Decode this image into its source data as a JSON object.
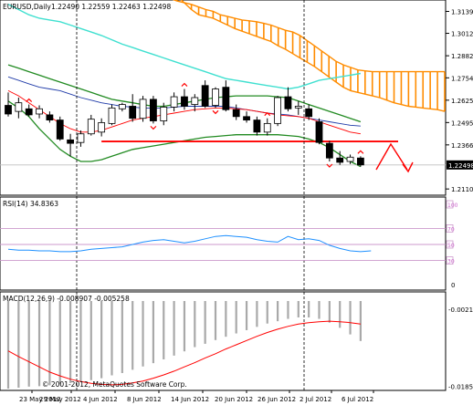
{
  "header": {
    "symbol": "EURUSD,Daily",
    "ohlc": "1.22490 1.22559 1.22463 1.22498"
  },
  "rsi_title": "RSI(14) 34.8363",
  "macd_title": "MACD(12,26,9) -0.008907 -0.005258",
  "copyright": "© 2001-2012, MetaQuotes Software Corp.",
  "colors": {
    "bull": "#ffffff",
    "bear": "#000000",
    "cloud": "#ff8c00",
    "upper_band": "#40e0d0",
    "envelope": "#228b22",
    "ma_red": "#ff0000",
    "ma_blue": "#1e3aa8",
    "rsi_line": "#1e90ff",
    "level": "#cc99cc",
    "macd_hist": "#a9a9a9",
    "macd_signal": "#ff0000",
    "price_line": "#ff0000"
  },
  "chart_data": [
    {
      "type": "candlestick",
      "symbol": "EURUSD,Daily",
      "x_tick_labels": [
        "23 May 2012",
        "29 May 2012",
        "4 Jun 2012",
        "8 Jun 2012",
        "14 Jun 2012",
        "20 Jun 2012",
        "26 Jun 2012",
        "2 Jul 2012",
        "6 Jul 2012"
      ],
      "y_tick_labels": [
        "1.31395",
        "1.30125",
        "1.28825",
        "1.27545",
        "1.26250",
        "1.24955",
        "1.23660",
        "1.22498",
        "1.21105"
      ],
      "ylim": [
        1.2085,
        1.3195
      ],
      "current_price": 1.22498,
      "horizontal_line": 1.2386,
      "candles": [
        {
          "o": 1.2595,
          "h": 1.267,
          "l": 1.253,
          "c": 1.2545
        },
        {
          "o": 1.256,
          "h": 1.264,
          "l": 1.252,
          "c": 1.261
        },
        {
          "o": 1.2575,
          "h": 1.26,
          "l": 1.253,
          "c": 1.254
        },
        {
          "o": 1.2545,
          "h": 1.2595,
          "l": 1.252,
          "c": 1.2575
        },
        {
          "o": 1.254,
          "h": 1.256,
          "l": 1.2495,
          "c": 1.251
        },
        {
          "o": 1.251,
          "h": 1.253,
          "l": 1.239,
          "c": 1.24
        },
        {
          "o": 1.2395,
          "h": 1.243,
          "l": 1.23,
          "c": 1.2375
        },
        {
          "o": 1.238,
          "h": 1.245,
          "l": 1.2355,
          "c": 1.243
        },
        {
          "o": 1.243,
          "h": 1.254,
          "l": 1.242,
          "c": 1.2515
        },
        {
          "o": 1.244,
          "h": 1.252,
          "l": 1.2415,
          "c": 1.2495
        },
        {
          "o": 1.249,
          "h": 1.26,
          "l": 1.248,
          "c": 1.258
        },
        {
          "o": 1.2575,
          "h": 1.261,
          "l": 1.256,
          "c": 1.26
        },
        {
          "o": 1.259,
          "h": 1.266,
          "l": 1.25,
          "c": 1.252
        },
        {
          "o": 1.252,
          "h": 1.265,
          "l": 1.25,
          "c": 1.263
        },
        {
          "o": 1.263,
          "h": 1.265,
          "l": 1.249,
          "c": 1.2505
        },
        {
          "o": 1.2505,
          "h": 1.261,
          "l": 1.248,
          "c": 1.2585
        },
        {
          "o": 1.2585,
          "h": 1.267,
          "l": 1.256,
          "c": 1.2645
        },
        {
          "o": 1.2645,
          "h": 1.269,
          "l": 1.257,
          "c": 1.259
        },
        {
          "o": 1.26,
          "h": 1.266,
          "l": 1.256,
          "c": 1.264
        },
        {
          "o": 1.271,
          "h": 1.274,
          "l": 1.258,
          "c": 1.259
        },
        {
          "o": 1.2595,
          "h": 1.27,
          "l": 1.258,
          "c": 1.269
        },
        {
          "o": 1.27,
          "h": 1.274,
          "l": 1.256,
          "c": 1.257
        },
        {
          "o": 1.257,
          "h": 1.26,
          "l": 1.251,
          "c": 1.253
        },
        {
          "o": 1.253,
          "h": 1.256,
          "l": 1.2495,
          "c": 1.251
        },
        {
          "o": 1.251,
          "h": 1.253,
          "l": 1.242,
          "c": 1.244
        },
        {
          "o": 1.244,
          "h": 1.252,
          "l": 1.242,
          "c": 1.249
        },
        {
          "o": 1.249,
          "h": 1.265,
          "l": 1.2475,
          "c": 1.264
        },
        {
          "o": 1.2645,
          "h": 1.27,
          "l": 1.256,
          "c": 1.2575
        },
        {
          "o": 1.258,
          "h": 1.262,
          "l": 1.254,
          "c": 1.259
        },
        {
          "o": 1.2575,
          "h": 1.26,
          "l": 1.251,
          "c": 1.253
        },
        {
          "o": 1.25,
          "h": 1.252,
          "l": 1.237,
          "c": 1.238
        },
        {
          "o": 1.2375,
          "h": 1.239,
          "l": 1.227,
          "c": 1.229
        },
        {
          "o": 1.229,
          "h": 1.233,
          "l": 1.225,
          "c": 1.2265
        },
        {
          "o": 1.227,
          "h": 1.231,
          "l": 1.2255,
          "c": 1.2295
        },
        {
          "o": 1.229,
          "h": 1.23,
          "l": 1.224,
          "c": 1.225
        }
      ],
      "overlays": {
        "cloud_upper": [
          1.325,
          1.323,
          1.3215,
          1.32,
          1.319,
          1.318,
          1.3165,
          1.315,
          1.314,
          1.312,
          1.311,
          1.31,
          1.309,
          1.3085,
          1.308,
          1.307,
          1.306,
          1.3045,
          1.303,
          1.302,
          1.3,
          1.297,
          1.294,
          1.291,
          1.288,
          1.285,
          1.283,
          1.2815,
          1.28,
          1.2795,
          1.279,
          1.279,
          1.279,
          1.279,
          1.279,
          1.279,
          1.279,
          1.279,
          1.279,
          1.279,
          1.279
        ],
        "cloud_lower": [
          1.332,
          1.33,
          1.326,
          1.323,
          1.319,
          1.315,
          1.312,
          1.311,
          1.31,
          1.308,
          1.306,
          1.304,
          1.3025,
          1.301,
          1.2995,
          1.298,
          1.2965,
          1.294,
          1.292,
          1.2895,
          1.287,
          1.2845,
          1.282,
          1.279,
          1.276,
          1.273,
          1.27,
          1.268,
          1.267,
          1.266,
          1.265,
          1.264,
          1.2625,
          1.261,
          1.26,
          1.259,
          1.2585,
          1.258,
          1.2575,
          1.257,
          1.256
        ],
        "upper_band": [
          1.318,
          1.315,
          1.312,
          1.31,
          1.309,
          1.308,
          1.306,
          1.304,
          1.302,
          1.3,
          1.2975,
          1.295,
          1.293,
          1.291,
          1.289,
          1.287,
          1.285,
          1.283,
          1.281,
          1.279,
          1.277,
          1.275,
          1.274,
          1.273,
          1.272,
          1.271,
          1.27,
          1.269,
          1.27,
          1.272,
          1.274,
          1.275,
          1.276,
          1.277,
          1.278
        ],
        "envelope_upper": [
          1.283,
          1.281,
          1.279,
          1.277,
          1.275,
          1.273,
          1.271,
          1.269,
          1.267,
          1.265,
          1.263,
          1.262,
          1.261,
          1.26,
          1.259,
          1.259,
          1.26,
          1.261,
          1.262,
          1.263,
          1.264,
          1.2645,
          1.265,
          1.265,
          1.265,
          1.265,
          1.2645,
          1.264,
          1.262,
          1.26,
          1.258,
          1.256,
          1.254,
          1.252,
          1.25
        ],
        "envelope_lower": [
          1.262,
          1.258,
          1.253,
          1.246,
          1.24,
          1.234,
          1.23,
          1.227,
          1.227,
          1.228,
          1.23,
          1.232,
          1.234,
          1.235,
          1.236,
          1.237,
          1.238,
          1.239,
          1.24,
          1.241,
          1.2415,
          1.242,
          1.2425,
          1.2425,
          1.2425,
          1.2425,
          1.2425,
          1.242,
          1.2415,
          1.24,
          1.238,
          1.235,
          1.231,
          1.227,
          1.224
        ],
        "ma_blue": [
          1.276,
          1.274,
          1.272,
          1.27,
          1.269,
          1.268,
          1.266,
          1.264,
          1.2625,
          1.261,
          1.26,
          1.259,
          1.2585,
          1.258,
          1.258,
          1.258,
          1.2585,
          1.259,
          1.259,
          1.259,
          1.259,
          1.259,
          1.258,
          1.257,
          1.256,
          1.255,
          1.2545,
          1.254,
          1.253,
          1.252,
          1.251,
          1.25,
          1.249,
          1.248,
          1.2475
        ],
        "ma_red": [
          1.268,
          1.265,
          1.261,
          1.257,
          1.253,
          1.249,
          1.246,
          1.244,
          1.244,
          1.245,
          1.247,
          1.249,
          1.251,
          1.252,
          1.253,
          1.254,
          1.255,
          1.256,
          1.257,
          1.2575,
          1.258,
          1.258,
          1.2575,
          1.257,
          1.256,
          1.255,
          1.254,
          1.2535,
          1.253,
          1.252,
          1.25,
          1.248,
          1.246,
          1.244,
          1.243
        ]
      },
      "arrow_markers_up": [
        2,
        17,
        25,
        34
      ],
      "arrow_markers_down": [
        14,
        20,
        31
      ],
      "forecast_path": [
        [
          35,
          1.2385
        ],
        [
          36.5,
          1.224
        ],
        [
          37,
          1.2255
        ]
      ]
    },
    {
      "type": "line",
      "name": "RSI(14)",
      "levels": [
        70,
        50,
        30
      ],
      "ylim": [
        0,
        100
      ],
      "y_tick_labels": [
        "100",
        "70",
        "50",
        "30",
        "0"
      ],
      "values": [
        44,
        43,
        43,
        42,
        42,
        41,
        41,
        42,
        44,
        45,
        46,
        47,
        50,
        53,
        55,
        56,
        54,
        52,
        54,
        57,
        60,
        61,
        60,
        59,
        56,
        54,
        53,
        60,
        56,
        57,
        55,
        49,
        45,
        42,
        41,
        42
      ]
    },
    {
      "type": "bar+line",
      "name": "MACD(12,26,9)",
      "ylim": [
        -0.019,
        -0.0008
      ],
      "y_tick_labels": [
        "-0.00217",
        "-0.01852"
      ],
      "histogram": [
        -0.019,
        -0.0188,
        -0.0186,
        -0.0185,
        -0.0183,
        -0.0181,
        -0.0178,
        -0.0176,
        -0.0172,
        -0.0168,
        -0.0162,
        -0.0157,
        -0.015,
        -0.0143,
        -0.0136,
        -0.0128,
        -0.012,
        -0.0111,
        -0.0102,
        -0.0095,
        -0.0087,
        -0.008,
        -0.0073,
        -0.0066,
        -0.0059,
        -0.0052,
        -0.0047,
        -0.0042,
        -0.0039,
        -0.0039,
        -0.0042,
        -0.005,
        -0.0061,
        -0.0075,
        -0.0089
      ],
      "signal": [
        -0.011,
        -0.0122,
        -0.0133,
        -0.0144,
        -0.0155,
        -0.0163,
        -0.017,
        -0.0175,
        -0.0179,
        -0.0181,
        -0.0182,
        -0.0181,
        -0.0178,
        -0.0174,
        -0.0168,
        -0.0161,
        -0.0153,
        -0.0144,
        -0.0135,
        -0.0125,
        -0.0116,
        -0.0106,
        -0.0097,
        -0.0088,
        -0.0079,
        -0.0071,
        -0.0064,
        -0.0058,
        -0.0053,
        -0.005,
        -0.0048,
        -0.0047,
        -0.0048,
        -0.005,
        -0.0053
      ]
    }
  ]
}
